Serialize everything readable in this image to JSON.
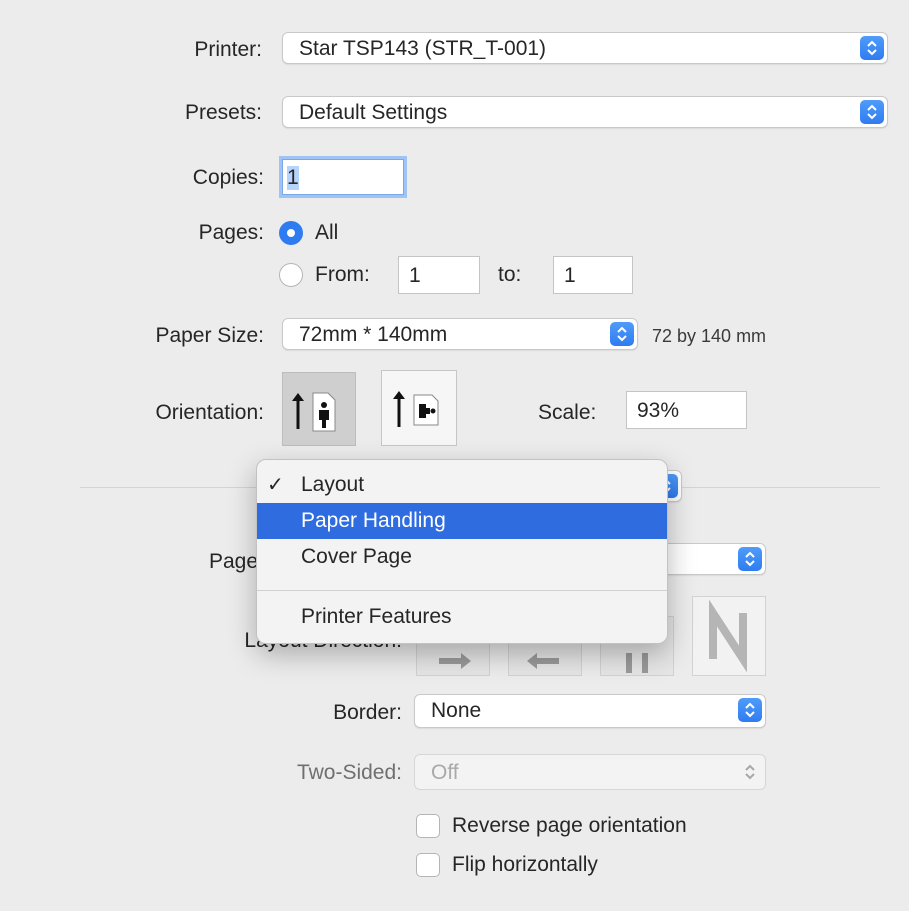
{
  "printer": {
    "label": "Printer:",
    "value": "Star TSP143 (STR_T-001)"
  },
  "presets": {
    "label": "Presets:",
    "value": "Default Settings"
  },
  "copies": {
    "label": "Copies:",
    "value": "1"
  },
  "pages": {
    "label": "Pages:",
    "all_label": "All",
    "from_label": "From:",
    "from_value": "1",
    "to_label": "to:",
    "to_value": "1",
    "selected": "All"
  },
  "paper_size": {
    "label": "Paper Size:",
    "value": "72mm * 140mm",
    "description": "72 by 140 mm"
  },
  "orientation": {
    "label": "Orientation:",
    "options": [
      "portrait",
      "landscape"
    ],
    "selected": "portrait"
  },
  "scale": {
    "label": "Scale:",
    "value": "93%"
  },
  "section_menu": {
    "items": [
      {
        "label": "Layout",
        "checked": true,
        "highlighted": false
      },
      {
        "label": "Paper Handling",
        "checked": false,
        "highlighted": true
      },
      {
        "label": "Cover Page",
        "checked": false,
        "highlighted": false
      },
      {
        "label": "Printer Features",
        "checked": false,
        "highlighted": false
      }
    ],
    "check_glyph": "✓"
  },
  "layout": {
    "pages_per_sheet_label": "Page",
    "layout_direction_label": "Layout Direction:",
    "border": {
      "label": "Border:",
      "value": "None"
    },
    "two_sided": {
      "label": "Two-Sided:",
      "value": "Off"
    },
    "reverse_orientation": {
      "label": "Reverse page orientation",
      "checked": false
    },
    "flip_horizontally": {
      "label": "Flip horizontally",
      "checked": false
    }
  },
  "colors": {
    "accent": "#2f7cf1",
    "menu_highlight": "#2f6ce0",
    "background": "#ececec"
  }
}
